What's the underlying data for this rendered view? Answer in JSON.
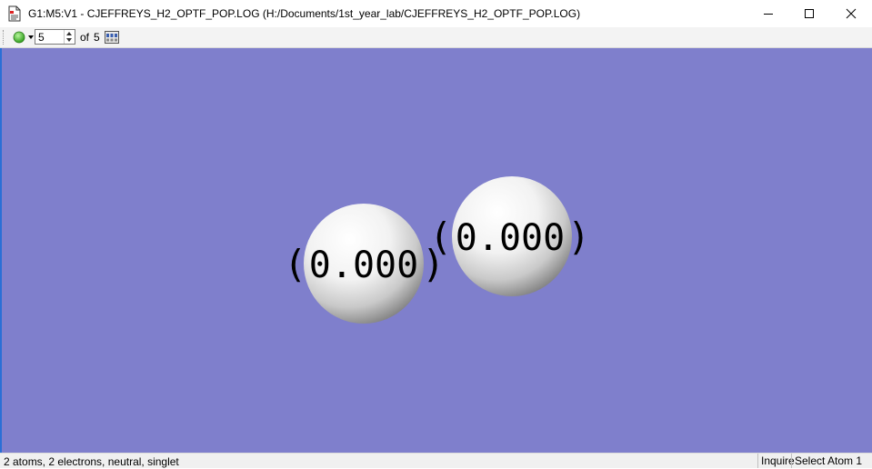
{
  "window": {
    "title": "G1:M5:V1 - CJEFFREYS_H2_OPTF_POP.LOG (H:/Documents/1st_year_lab/CJEFFREYS_H2_OPTF_POP.LOG)",
    "icon": "gaussview-log-file-icon",
    "controls": [
      "minimize-icon",
      "maximize-icon",
      "close-icon"
    ]
  },
  "toolbar": {
    "status_light_color": "#3fbf2a",
    "frame_value": "5",
    "of_label": "of",
    "frame_total": "5",
    "frames_icon": "frame-grid-icon"
  },
  "viewport": {
    "background": "#7f7fcc",
    "atoms": [
      {
        "label": "0.000",
        "color": "#ffffff"
      },
      {
        "label": "0.000",
        "color": "#ffffff"
      }
    ]
  },
  "statusbar": {
    "summary": "2 atoms, 2 electrons, neutral, singlet",
    "mode": "Inquire",
    "select": "Select Atom 1"
  }
}
